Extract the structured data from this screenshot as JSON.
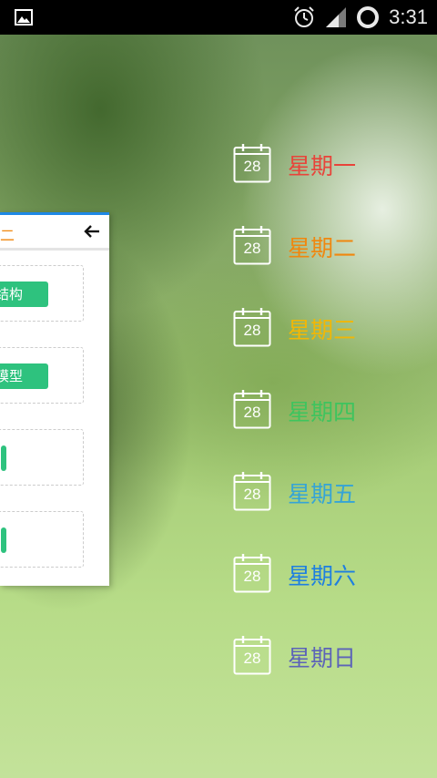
{
  "status_bar": {
    "time": "3:31",
    "icons": [
      "picture-icon",
      "alarm-icon",
      "signal-icon",
      "loading-circle-icon"
    ]
  },
  "card": {
    "title": "期二",
    "tags": [
      "结构",
      "模型",
      "",
      ""
    ],
    "colors": {
      "accent_bar": "#1e88e5",
      "title": "#f0870e",
      "tag": "#2ec27e"
    }
  },
  "days": [
    {
      "label": "星期一",
      "date": "28",
      "color": "#e8443a"
    },
    {
      "label": "星期二",
      "date": "28",
      "color": "#f0870e"
    },
    {
      "label": "星期三",
      "date": "28",
      "color": "#f2b705"
    },
    {
      "label": "星期四",
      "date": "28",
      "color": "#3ec45e"
    },
    {
      "label": "星期五",
      "date": "28",
      "color": "#35a4d6"
    },
    {
      "label": "星期六",
      "date": "28",
      "color": "#1e7fe0"
    },
    {
      "label": "星期日",
      "date": "28",
      "color": "#5c63b8"
    }
  ]
}
